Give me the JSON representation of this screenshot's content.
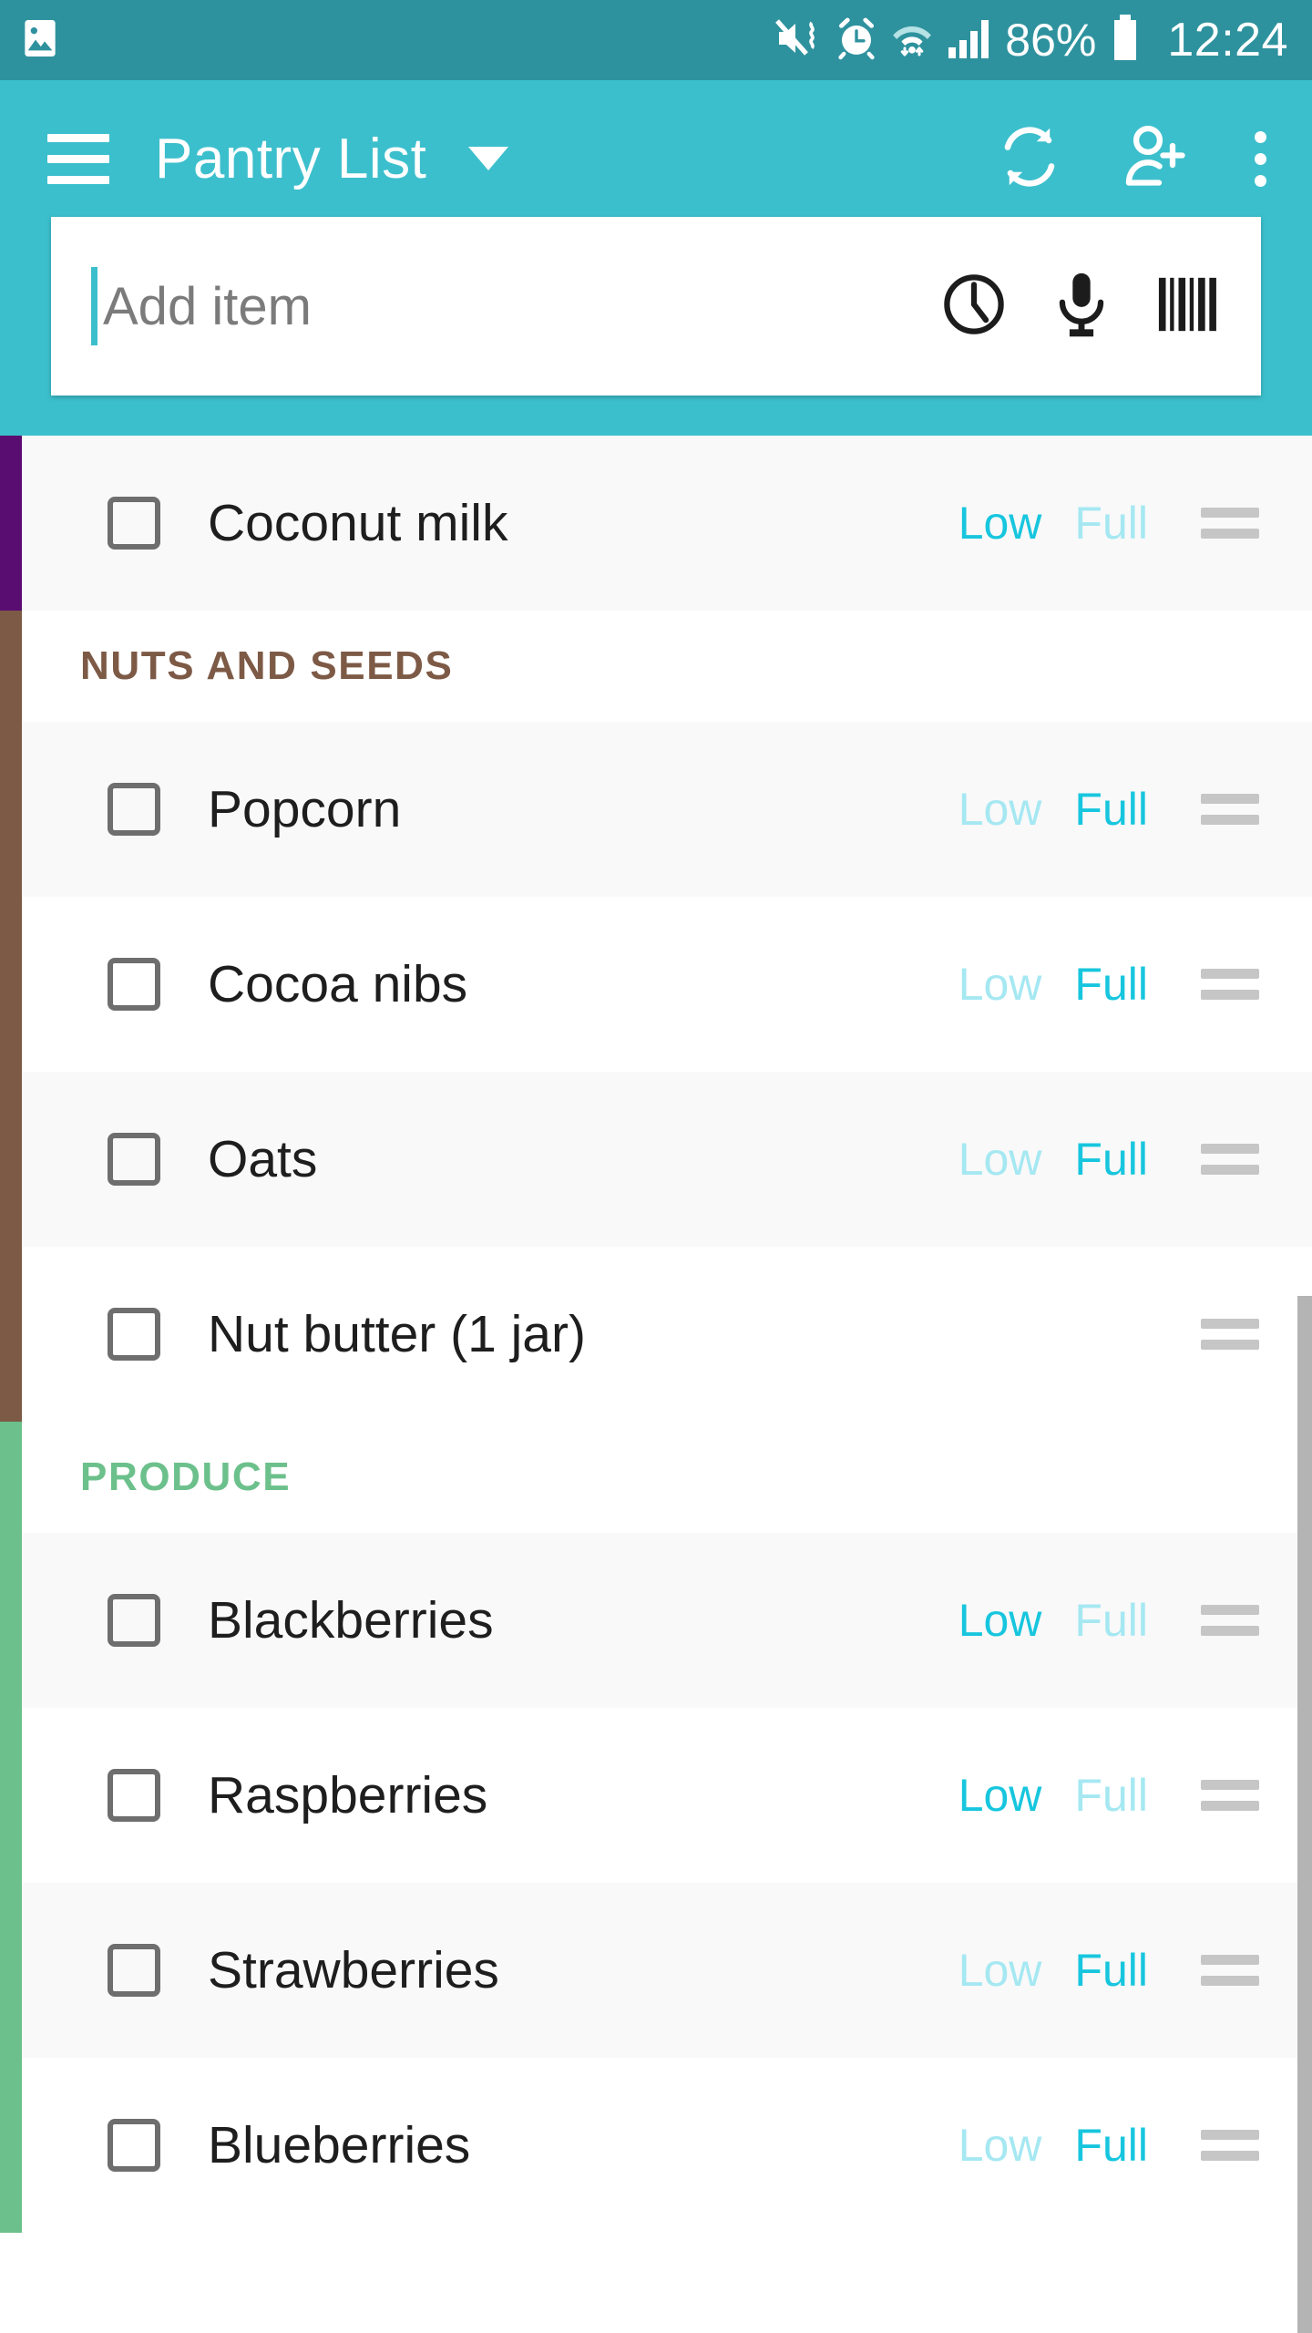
{
  "status_bar": {
    "time": "12:24",
    "battery_percent": "86%",
    "icons": [
      "image-icon",
      "mute-vibrate-icon",
      "alarm-clock-icon",
      "wifi-icon",
      "signal-bars-icon",
      "battery-icon"
    ]
  },
  "app_bar": {
    "menu_icon": "hamburger-menu-icon",
    "title": "Pantry List",
    "dropdown_icon": "chevron-down-icon",
    "actions": [
      "sync-icon",
      "add-person-icon",
      "overflow-menu-icon"
    ]
  },
  "search": {
    "placeholder": "Add item",
    "value": "",
    "icons": [
      "history-clock-icon",
      "microphone-icon",
      "barcode-icon"
    ]
  },
  "colors": {
    "status_bar": "#2E929E",
    "app_bar": "#3CBFCC",
    "accent": "#17C6DE",
    "accent_inactive": "#A5E8F2",
    "category_dairy": "#5A0D70",
    "category_nuts": "#7D5A46",
    "category_produce": "#6CC08B"
  },
  "list": {
    "sections": [
      {
        "label": "",
        "color": "#5A0D70",
        "show_header": false,
        "items": [
          {
            "name": "Coconut milk",
            "checked": false,
            "low_label": "Low",
            "full_label": "Full",
            "state": "low",
            "has_state": true,
            "alt": true
          }
        ]
      },
      {
        "label": "NUTS AND SEEDS",
        "color": "#7D5A46",
        "show_header": true,
        "items": [
          {
            "name": "Popcorn",
            "checked": false,
            "low_label": "Low",
            "full_label": "Full",
            "state": "full",
            "has_state": true,
            "alt": true
          },
          {
            "name": "Cocoa nibs",
            "checked": false,
            "low_label": "Low",
            "full_label": "Full",
            "state": "full",
            "has_state": true,
            "alt": false
          },
          {
            "name": "Oats",
            "checked": false,
            "low_label": "Low",
            "full_label": "Full",
            "state": "full",
            "has_state": true,
            "alt": true
          },
          {
            "name": "Nut butter (1 jar)",
            "checked": false,
            "low_label": "",
            "full_label": "",
            "state": "none",
            "has_state": false,
            "alt": false
          }
        ]
      },
      {
        "label": "PRODUCE",
        "color": "#6CC08B",
        "show_header": true,
        "items": [
          {
            "name": "Blackberries",
            "checked": false,
            "low_label": "Low",
            "full_label": "Full",
            "state": "low",
            "has_state": true,
            "alt": true
          },
          {
            "name": "Raspberries",
            "checked": false,
            "low_label": "Low",
            "full_label": "Full",
            "state": "low",
            "has_state": true,
            "alt": false
          },
          {
            "name": "Strawberries",
            "checked": false,
            "low_label": "Low",
            "full_label": "Full",
            "state": "full",
            "has_state": true,
            "alt": true
          },
          {
            "name": "Blueberries",
            "checked": false,
            "low_label": "Low",
            "full_label": "Full",
            "state": "full",
            "has_state": true,
            "alt": false
          }
        ]
      }
    ]
  }
}
